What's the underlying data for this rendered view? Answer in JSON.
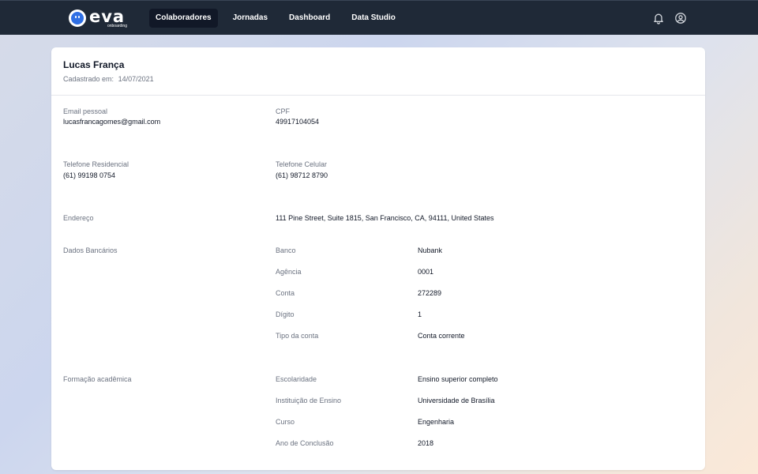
{
  "app": {
    "logo_text": "eva",
    "logo_subtext": "onboarding"
  },
  "nav": {
    "items": [
      {
        "label": "Colaboradores",
        "active": true
      },
      {
        "label": "Jornadas",
        "active": false
      },
      {
        "label": "Dashboard",
        "active": false
      },
      {
        "label": "Data Studio",
        "active": false
      }
    ],
    "icons": [
      "bell-icon",
      "user-circle-icon"
    ]
  },
  "profile": {
    "name": "Lucas França",
    "registered_label": "Cadastrado em:",
    "registered_date": "14/07/2021"
  },
  "fields": {
    "email": {
      "label": "Email pessoal",
      "value": "lucasfrancagomes@gmail.com"
    },
    "cpf": {
      "label": "CPF",
      "value": "49917104054"
    },
    "home_phone": {
      "label": "Telefone Residencial",
      "value": "(61) 99198 0754"
    },
    "mobile_phone": {
      "label": "Telefone Celular",
      "value": "(61) 98712 8790"
    },
    "address": {
      "label": "Endereço",
      "value": "111 Pine Street, Suite 1815, San Francisco, CA, 94111, United States"
    }
  },
  "bank": {
    "section_label": "Dados Bancários",
    "rows": [
      {
        "label": "Banco",
        "value": "Nubank"
      },
      {
        "label": "Agência",
        "value": "0001"
      },
      {
        "label": "Conta",
        "value": "272289"
      },
      {
        "label": "Dígito",
        "value": "1"
      },
      {
        "label": "Tipo da conta",
        "value": "Conta corrente"
      }
    ]
  },
  "education": {
    "section_label": "Formação acadêmica",
    "rows": [
      {
        "label": "Escolaridade",
        "value": "Ensino superior completo"
      },
      {
        "label": "Instituição de Ensino",
        "value": "Universidade de Brasília"
      },
      {
        "label": "Curso",
        "value": "Engenharia"
      },
      {
        "label": "Ano de Conclusão",
        "value": "2018"
      }
    ]
  },
  "colors": {
    "topbar": "#1f2937",
    "nav_active": "#111827",
    "logo_accent": "#2f6fe4",
    "label_text": "#6b7280",
    "value_text": "#111827"
  }
}
